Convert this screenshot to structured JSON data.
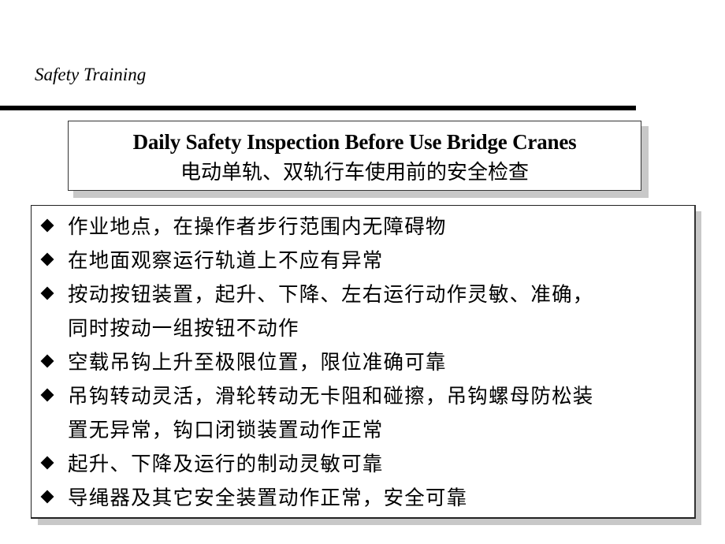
{
  "header": {
    "label": "Safety Training"
  },
  "title": {
    "english": "Daily Safety Inspection Before Use Bridge Cranes",
    "chinese": "电动单轨、双轨行车使用前的安全检查"
  },
  "checklist": {
    "bullet_icon": "black-diamond",
    "items": [
      {
        "lines": [
          "作业地点，在操作者步行范围内无障碍物"
        ]
      },
      {
        "lines": [
          "在地面观察运行轨道上不应有异常"
        ]
      },
      {
        "lines": [
          "按动按钮装置，起升、下降、左右运行动作灵敏、准确，",
          "同时按动一组按钮不动作"
        ]
      },
      {
        "lines": [
          "空载吊钩上升至极限位置，限位准确可靠"
        ]
      },
      {
        "lines": [
          "吊钩转动灵活，滑轮转动无卡阻和碰擦，吊钩螺母防松装",
          "置无异常，钩口闭锁装置动作正常"
        ]
      },
      {
        "lines": [
          "起升、下降及运行的制动灵敏可靠"
        ]
      },
      {
        "lines": [
          "导绳器及其它安全装置动作正常，安全可靠"
        ]
      }
    ]
  }
}
